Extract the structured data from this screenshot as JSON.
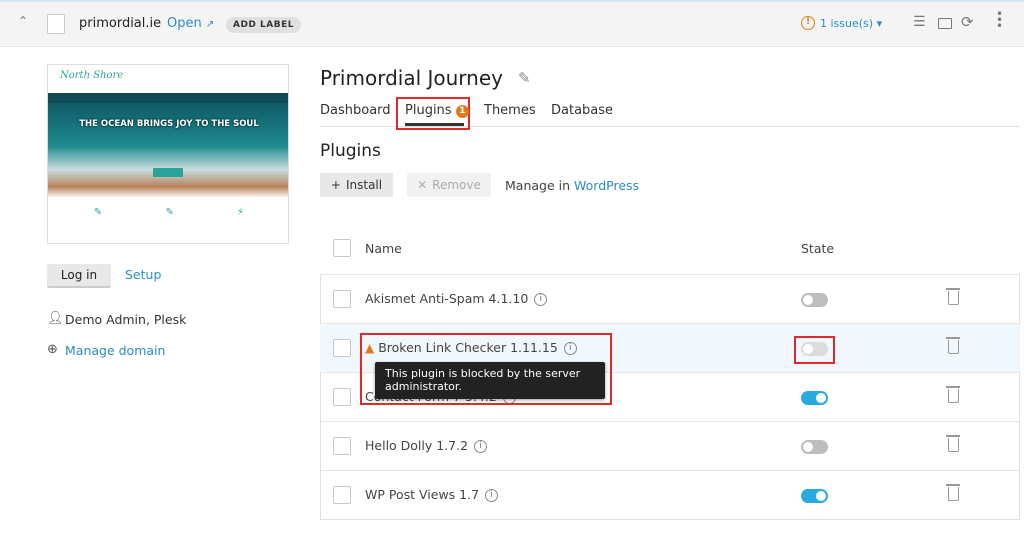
{
  "topbar": {
    "domain": "primordial.ie",
    "open_label": "Open",
    "add_label": "ADD LABEL",
    "issues": "1 issue(s)"
  },
  "sidebar": {
    "thumbnail_title": "North Shore",
    "thumbnail_headline": "THE OCEAN BRINGS JOY TO THE SOUL",
    "login_label": "Log in",
    "setup_label": "Setup",
    "owner": "Demo Admin, Plesk",
    "manage_domain": "Manage domain"
  },
  "main": {
    "title": "Primordial Journey",
    "tabs": [
      {
        "label": "Dashboard"
      },
      {
        "label": "Plugins",
        "badge": "1"
      },
      {
        "label": "Themes"
      },
      {
        "label": "Database"
      }
    ],
    "section_title": "Plugins",
    "install_label": "Install",
    "remove_label": "Remove",
    "manage_in": "Manage in",
    "manage_link": "WordPress",
    "columns": {
      "name": "Name",
      "state": "State"
    },
    "plugins": [
      {
        "name": "Akismet Anti-Spam 4.1.10",
        "state": "off"
      },
      {
        "name": "Broken Link Checker 1.11.15",
        "state": "blocked",
        "warning": true
      },
      {
        "name": "Contact Form 7 5.4.2",
        "state": "on"
      },
      {
        "name": "Hello Dolly 1.7.2",
        "state": "off"
      },
      {
        "name": "WP Post Views 1.7",
        "state": "on"
      }
    ],
    "tooltip": "This plugin is blocked by the server administrator."
  },
  "colors": {
    "accent": "#2a8dc4",
    "warning": "#e07b1a",
    "toggle_on": "#28a9e0",
    "highlight": "#e02a2a"
  }
}
